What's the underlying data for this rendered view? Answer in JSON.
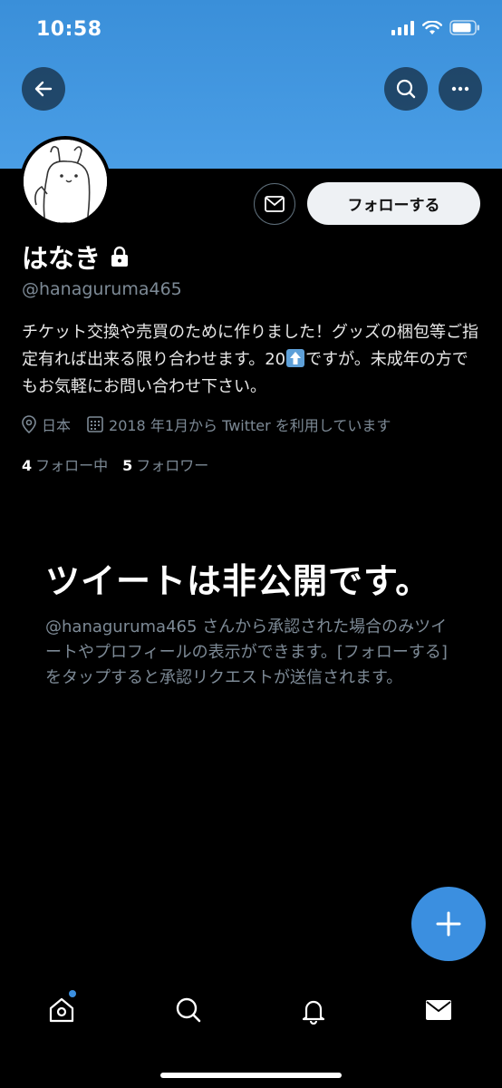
{
  "status_bar": {
    "time": "10:58"
  },
  "profile": {
    "name": "はなき",
    "handle": "@hanaguruma465",
    "bio_part1": "チケット交換や売買のために作りました！グッズの梱包等ご指定有れば出来る限り合わせます。20",
    "bio_part2": "ですが。未成年の方でもお気軽にお問い合わせ下さい。",
    "location": "日本",
    "joined": "2018 年1月から Twitter を利用しています",
    "following_count": "4",
    "following_label": "フォロー中",
    "followers_count": "5",
    "followers_label": "フォロワー"
  },
  "actions": {
    "follow_label": "フォローする"
  },
  "private_notice": {
    "title": "ツイートは非公開です。",
    "description": "@hanaguruma465 さんから承認された場合のみツイートやプロフィールの表示ができます。[フォローする] をタップすると承認リクエストが送信されます。"
  },
  "colors": {
    "accent": "#3b8fe0",
    "banner": "#4a9ee6",
    "muted": "#7d8a96"
  },
  "icons": [
    "back-arrow-icon",
    "search-icon",
    "more-icon",
    "mail-icon",
    "lock-icon",
    "location-pin-icon",
    "calendar-icon",
    "plus-icon",
    "home-icon",
    "bell-icon"
  ]
}
